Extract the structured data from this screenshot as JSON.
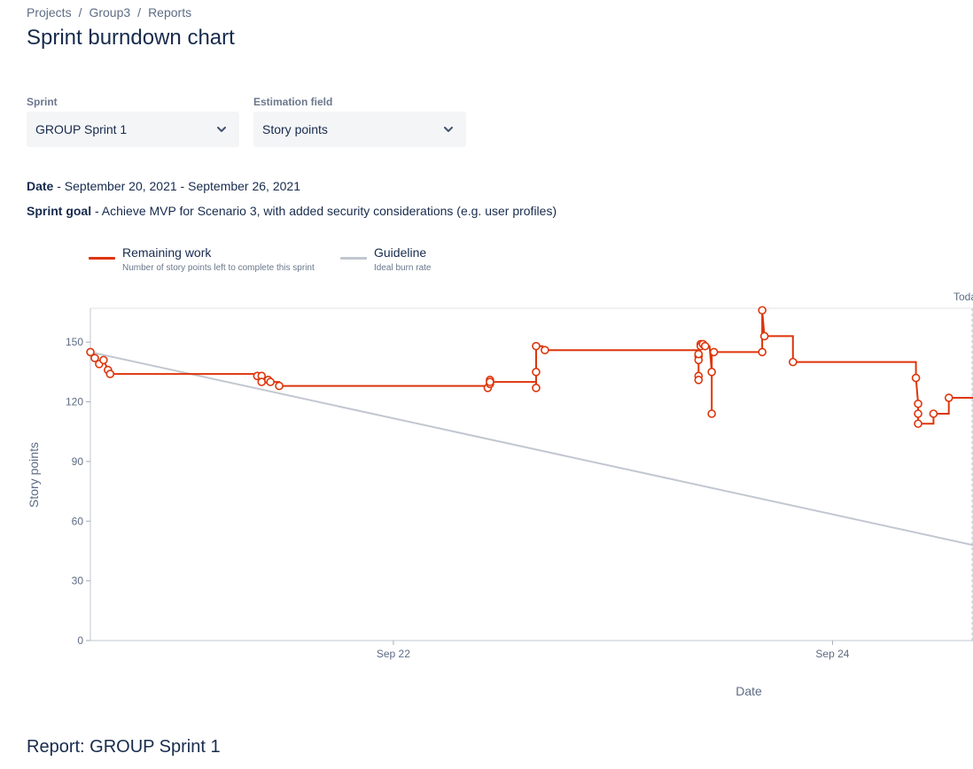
{
  "breadcrumb": {
    "items": [
      "Projects",
      "Group3",
      "Reports"
    ],
    "separator": "/"
  },
  "page": {
    "title": "Sprint burndown chart",
    "report_title": "Report: GROUP Sprint 1"
  },
  "filters": {
    "sprint": {
      "label": "Sprint",
      "value": "GROUP Sprint 1",
      "icon": "chevron-down-icon"
    },
    "estimation": {
      "label": "Estimation field",
      "value": "Story points",
      "icon": "chevron-down-icon"
    }
  },
  "info": {
    "date_label": "Date",
    "date_value": " - September 20, 2021 - September 26, 2021",
    "goal_label": "Sprint goal",
    "goal_value": " - Achieve MVP for Scenario 3, with added security considerations (e.g. user profiles)"
  },
  "legend": [
    {
      "title": "Remaining work",
      "desc": "Number of story points left to complete this sprint",
      "color": "#de350b"
    },
    {
      "title": "Guideline",
      "desc": "Ideal burn rate",
      "color": "#c1c7d0"
    }
  ],
  "chart_data": {
    "type": "line",
    "title": "",
    "xlabel": "Date",
    "ylabel": "Story points",
    "x_unit": "days since Sep 20, 2021",
    "x_ticks": [
      {
        "label": "Sep 22",
        "x": 2.0
      },
      {
        "label": "Sep 24",
        "x": 4.0
      }
    ],
    "xlim": [
      0.62,
      4.64
    ],
    "ylim": [
      0,
      167
    ],
    "y_ticks": [
      0,
      30,
      60,
      90,
      120,
      150
    ],
    "today_label": "Today",
    "today_x": 4.64,
    "grid": false,
    "guideline": {
      "name": "Guideline",
      "color": "#c1c7d0",
      "points": [
        [
          0.62,
          145
        ],
        [
          4.64,
          48
        ]
      ]
    },
    "remaining": {
      "name": "Remaining work",
      "color": "#de350b",
      "points": [
        [
          0.62,
          145
        ],
        [
          0.64,
          142
        ],
        [
          0.66,
          139
        ],
        [
          0.68,
          141
        ],
        [
          0.7,
          136
        ],
        [
          0.71,
          134
        ],
        [
          1.38,
          134
        ],
        [
          1.38,
          133
        ],
        [
          1.4,
          133
        ],
        [
          1.4,
          130
        ],
        [
          1.43,
          130
        ],
        [
          1.43,
          131
        ],
        [
          1.44,
          130
        ],
        [
          1.48,
          130
        ],
        [
          1.48,
          128
        ],
        [
          2.43,
          128
        ],
        [
          2.43,
          127
        ],
        [
          2.44,
          129
        ],
        [
          2.44,
          131
        ],
        [
          2.44,
          130
        ],
        [
          2.65,
          130
        ],
        [
          2.65,
          127
        ],
        [
          2.65,
          135
        ],
        [
          2.65,
          148
        ],
        [
          2.68,
          148
        ],
        [
          2.69,
          146
        ],
        [
          3.39,
          146
        ],
        [
          3.39,
          143
        ],
        [
          3.39,
          141
        ],
        [
          3.39,
          133
        ],
        [
          3.39,
          131
        ],
        [
          3.39,
          144
        ],
        [
          3.4,
          149
        ],
        [
          3.4,
          148
        ],
        [
          3.41,
          149
        ],
        [
          3.42,
          148
        ],
        [
          3.44,
          148
        ],
        [
          3.45,
          135
        ],
        [
          3.45,
          114
        ],
        [
          3.45,
          145
        ],
        [
          3.46,
          145
        ],
        [
          3.68,
          145
        ],
        [
          3.68,
          166
        ],
        [
          3.69,
          153
        ],
        [
          3.82,
          153
        ],
        [
          3.82,
          140
        ],
        [
          4.38,
          140
        ],
        [
          4.38,
          132
        ],
        [
          4.39,
          119
        ],
        [
          4.39,
          114
        ],
        [
          4.39,
          109
        ],
        [
          4.46,
          109
        ],
        [
          4.46,
          114
        ],
        [
          4.53,
          114
        ],
        [
          4.53,
          122
        ],
        [
          4.64,
          122
        ]
      ],
      "markers": [
        [
          0.62,
          145
        ],
        [
          0.64,
          142
        ],
        [
          0.66,
          139
        ],
        [
          0.68,
          141
        ],
        [
          0.7,
          136
        ],
        [
          0.71,
          134
        ],
        [
          1.38,
          133
        ],
        [
          1.4,
          133
        ],
        [
          1.4,
          130
        ],
        [
          1.43,
          131
        ],
        [
          1.44,
          130
        ],
        [
          1.48,
          128
        ],
        [
          2.43,
          127
        ],
        [
          2.44,
          129
        ],
        [
          2.44,
          131
        ],
        [
          2.44,
          130
        ],
        [
          2.65,
          127
        ],
        [
          2.65,
          135
        ],
        [
          2.65,
          148
        ],
        [
          2.69,
          146
        ],
        [
          3.39,
          143
        ],
        [
          3.39,
          141
        ],
        [
          3.39,
          133
        ],
        [
          3.39,
          131
        ],
        [
          3.39,
          144
        ],
        [
          3.4,
          149
        ],
        [
          3.4,
          148
        ],
        [
          3.41,
          149
        ],
        [
          3.42,
          148
        ],
        [
          3.45,
          135
        ],
        [
          3.45,
          114
        ],
        [
          3.46,
          145
        ],
        [
          3.68,
          166
        ],
        [
          3.69,
          153
        ],
        [
          3.68,
          145
        ],
        [
          3.82,
          140
        ],
        [
          4.38,
          132
        ],
        [
          4.39,
          119
        ],
        [
          4.39,
          114
        ],
        [
          4.39,
          109
        ],
        [
          4.46,
          114
        ],
        [
          4.53,
          122
        ]
      ]
    }
  }
}
